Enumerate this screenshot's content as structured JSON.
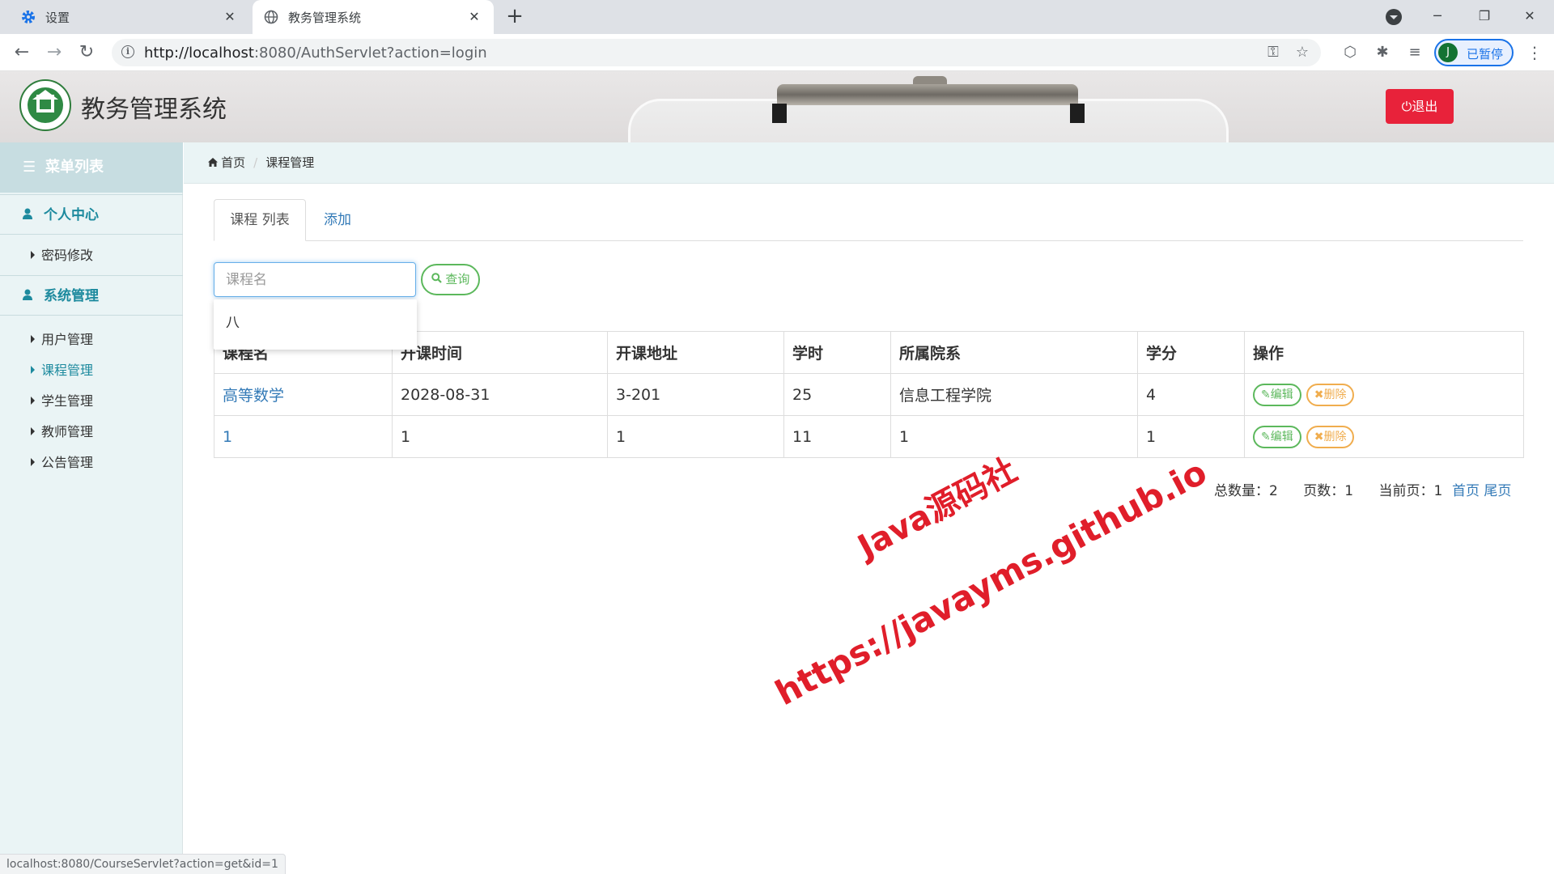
{
  "browser": {
    "tabs": [
      {
        "title": "设置",
        "icon": "gear-icon",
        "icon_color": "#1a73e8"
      },
      {
        "title": "教务管理系统",
        "icon": "globe-icon"
      }
    ],
    "close_glyph": "✕",
    "new_tab_glyph": "+",
    "url_host": "http://localhost",
    "url_rest": ":8080/AuthServlet?action=login",
    "profile_initial": "J",
    "profile_label": "已暂停",
    "status_url": "localhost:8080/CourseServlet?action=get&id=1"
  },
  "app": {
    "title": "教务管理系统",
    "logout_label": "退出",
    "logout_color": "#e8223a"
  },
  "sidebar": {
    "header": "菜单列表",
    "sections": [
      {
        "label": "个人中心",
        "items": [
          "密码修改"
        ]
      },
      {
        "label": "系统管理",
        "items": [
          "用户管理",
          "课程管理",
          "学生管理",
          "教师管理",
          "公告管理"
        ]
      }
    ],
    "active_item": "课程管理",
    "accent_color": "#1d8a9e"
  },
  "breadcrumb": {
    "home": "首页",
    "current": "课程管理"
  },
  "tabs": {
    "list": "课程 列表",
    "add": "添加"
  },
  "search": {
    "placeholder": "课程名",
    "button": "查询",
    "suggestion": "八"
  },
  "table": {
    "columns": [
      "课程名",
      "开课时间",
      "开课地址",
      "学时",
      "所属院系",
      "学分",
      "操作"
    ],
    "rows": [
      [
        "高等数学",
        "2028-08-31",
        "3-201",
        "25",
        "信息工程学院",
        "4"
      ],
      [
        "1",
        "1",
        "1",
        "11",
        "1",
        "1"
      ]
    ],
    "edit_label": "编辑",
    "delete_label": "删除"
  },
  "pagination": {
    "total_label": "总数量：",
    "total": "2",
    "pages_label": "页数：",
    "pages": "1",
    "current_label": "当前页：",
    "current": "1",
    "first": "首页",
    "last": "尾页"
  },
  "watermark": {
    "line1": "Java源码社",
    "line2": "https://javayms.github.io",
    "color": "#e01e2a"
  }
}
